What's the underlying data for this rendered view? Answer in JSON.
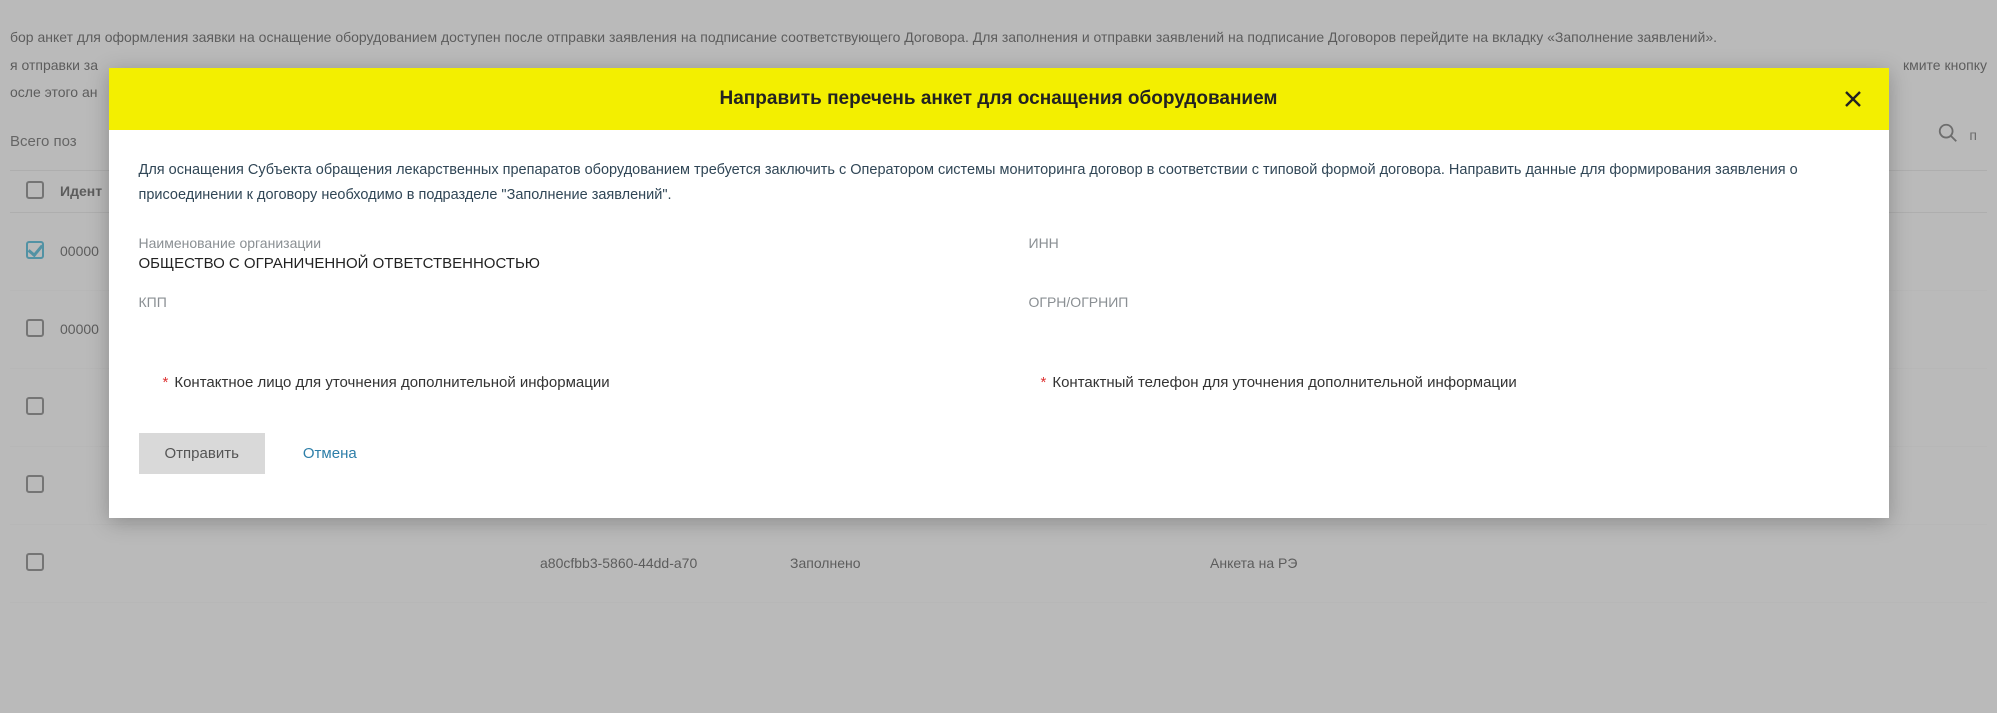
{
  "background": {
    "info1": "бор анкет для оформления заявки на оснащение оборудованием доступен после отправки заявления на подписание соответствующего Договора. Для заполнения и отправки заявлений на подписание Договоров перейдите на вкладку «Заполнение заявлений».",
    "info2_left": "я отправки за",
    "info2_right": "кмите кнопку",
    "info3": "осле этого ан",
    "total_label": "Всего поз",
    "search_trail": "п",
    "header_id": "Идент",
    "rows": [
      {
        "checked": true,
        "id": "00000",
        "guid": "",
        "status": "",
        "type": ""
      },
      {
        "checked": false,
        "id": "00000",
        "guid": "",
        "status": "",
        "type": ""
      },
      {
        "checked": false,
        "id": "",
        "guid": "",
        "status": "",
        "type": ""
      },
      {
        "checked": false,
        "id": "",
        "guid": "",
        "status": "",
        "type": ""
      },
      {
        "checked": false,
        "id": "",
        "guid": "a80cfbb3-5860-44dd-a70",
        "status": "Заполнено",
        "type": "Анкета на РЭ"
      }
    ]
  },
  "modal": {
    "title": "Направить перечень анкет для оснащения оборудованием",
    "description": "Для оснащения Субъекта обращения лекарственных препаратов оборудованием требуется заключить с Оператором системы мониторинга договор в соответствии с типовой формой договора. Направить данные для формирования заявления о присоединении к договору необходимо в подразделе \"Заполнение заявлений\".",
    "org_label": "Наименование организации",
    "org_value": "ОБЩЕСТВО С ОГРАНИЧЕННОЙ ОТВЕТСТВЕННОСТЬЮ",
    "inn_label": "ИНН",
    "inn_value": "",
    "kpp_label": "КПП",
    "kpp_value": "",
    "ogrn_label": "ОГРН/ОГРНИП",
    "ogrn_value": "",
    "contact_person_label": "Контактное лицо для уточнения дополнительной информации",
    "contact_phone_label": "Контактный телефон для уточнения дополнительной информации",
    "send_label": "Отправить",
    "cancel_label": "Отмена"
  }
}
